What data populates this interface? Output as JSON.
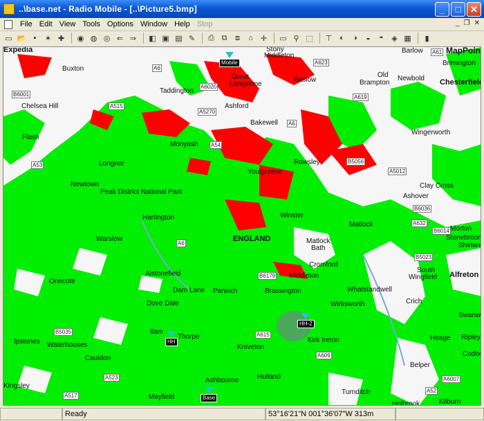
{
  "window": {
    "title": "..\\base.net - Radio Mobile - [..\\Picture5.bmp]"
  },
  "menu": [
    "File",
    "Edit",
    "View",
    "Tools",
    "Options",
    "Window",
    "Help",
    "Stop"
  ],
  "map": {
    "provider": "MapPoint",
    "places": [
      {
        "text": "Barlow",
        "cls": ""
      },
      {
        "text": "Brimington",
        "cls": ""
      },
      {
        "text": "Chesterfield",
        "cls": "bold"
      },
      {
        "text": "Old",
        "cls": ""
      },
      {
        "text": "Brampton",
        "cls": ""
      },
      {
        "text": "Newbold",
        "cls": ""
      },
      {
        "text": "Stony",
        "cls": ""
      },
      {
        "text": "Middleton",
        "cls": ""
      },
      {
        "text": "Baslow",
        "cls": ""
      },
      {
        "text": "Great",
        "cls": ""
      },
      {
        "text": "Longstone",
        "cls": ""
      },
      {
        "text": "Buxton",
        "cls": ""
      },
      {
        "text": "Taddington",
        "cls": ""
      },
      {
        "text": "Chelsea Hill",
        "cls": ""
      },
      {
        "text": "Ashford",
        "cls": ""
      },
      {
        "text": "Bakewell",
        "cls": ""
      },
      {
        "text": "Wingerworth",
        "cls": ""
      },
      {
        "text": "Flash",
        "cls": ""
      },
      {
        "text": "Monyash",
        "cls": ""
      },
      {
        "text": "Longnor",
        "cls": ""
      },
      {
        "text": "Youlgreave",
        "cls": ""
      },
      {
        "text": "Rowsley",
        "cls": ""
      },
      {
        "text": "Newtown",
        "cls": ""
      },
      {
        "text": "Peak District National Park",
        "cls": ""
      },
      {
        "text": "Clay Cross",
        "cls": ""
      },
      {
        "text": "Ashover",
        "cls": ""
      },
      {
        "text": "Hartington",
        "cls": ""
      },
      {
        "text": "Winster",
        "cls": ""
      },
      {
        "text": "Matlock",
        "cls": ""
      },
      {
        "text": "Morton",
        "cls": ""
      },
      {
        "text": "Warslow",
        "cls": ""
      },
      {
        "text": "ENGLAND",
        "cls": "bold"
      },
      {
        "text": "Matlock",
        "cls": ""
      },
      {
        "text": "Bath",
        "cls": ""
      },
      {
        "text": "Stonebroom",
        "cls": ""
      },
      {
        "text": "Shirland",
        "cls": ""
      },
      {
        "text": "Onecote",
        "cls": ""
      },
      {
        "text": "Alstonefield",
        "cls": ""
      },
      {
        "text": "Cromford",
        "cls": ""
      },
      {
        "text": "Middleton",
        "cls": ""
      },
      {
        "text": "South",
        "cls": ""
      },
      {
        "text": "Wingfield",
        "cls": ""
      },
      {
        "text": "Alfreton",
        "cls": "bold"
      },
      {
        "text": "Dam Lane",
        "cls": ""
      },
      {
        "text": "Parwich",
        "cls": ""
      },
      {
        "text": "Brassington",
        "cls": ""
      },
      {
        "text": "Whatstandwell",
        "cls": ""
      },
      {
        "text": "Crich",
        "cls": ""
      },
      {
        "text": "Dove Dale",
        "cls": ""
      },
      {
        "text": "Wirksworth",
        "cls": ""
      },
      {
        "text": "Swanwick",
        "cls": ""
      },
      {
        "text": "Ilam",
        "cls": ""
      },
      {
        "text": "Thorpe",
        "cls": ""
      },
      {
        "text": "Ipstones",
        "cls": ""
      },
      {
        "text": "Waterhouses",
        "cls": ""
      },
      {
        "text": "Kirk Ireton",
        "cls": ""
      },
      {
        "text": "Heage",
        "cls": ""
      },
      {
        "text": "Ripley",
        "cls": ""
      },
      {
        "text": "Kniveton",
        "cls": ""
      },
      {
        "text": "Cauldon",
        "cls": ""
      },
      {
        "text": "Belper",
        "cls": ""
      },
      {
        "text": "Codnor",
        "cls": ""
      },
      {
        "text": "Hulland",
        "cls": ""
      },
      {
        "text": "Kingsley",
        "cls": ""
      },
      {
        "text": "Ashbourne",
        "cls": ""
      },
      {
        "text": "Mayfield",
        "cls": ""
      },
      {
        "text": "Turnditch",
        "cls": ""
      },
      {
        "text": "Holbrook",
        "cls": ""
      },
      {
        "text": "Kilburn",
        "cls": ""
      },
      {
        "text": "Expedia",
        "cls": "bold"
      }
    ],
    "roads": [
      "A61",
      "A619",
      "A623",
      "A6",
      "A6020",
      "A515",
      "A5270",
      "A6",
      "B6001",
      "A54",
      "A53",
      "B5056",
      "A5012",
      "A632",
      "B6014",
      "A6",
      "A615",
      "B5035",
      "A523",
      "A52",
      "A517",
      "A609",
      "A6007",
      "B5023",
      "B6179",
      "B6036"
    ],
    "units": [
      {
        "label": "Mobile",
        "name": "unit-mobile"
      },
      {
        "label": "HH",
        "name": "unit-hh"
      },
      {
        "label": "HH-2",
        "name": "unit-hh-2"
      },
      {
        "label": "Base",
        "name": "unit-base"
      }
    ],
    "coverage_colors": {
      "strong": "#00ee00",
      "weak": "#ff0000",
      "background": "#f6f6f6"
    }
  },
  "status": {
    "message": "Ready",
    "coords": "53°16'21\"N 001°36'07\"W 313m"
  }
}
